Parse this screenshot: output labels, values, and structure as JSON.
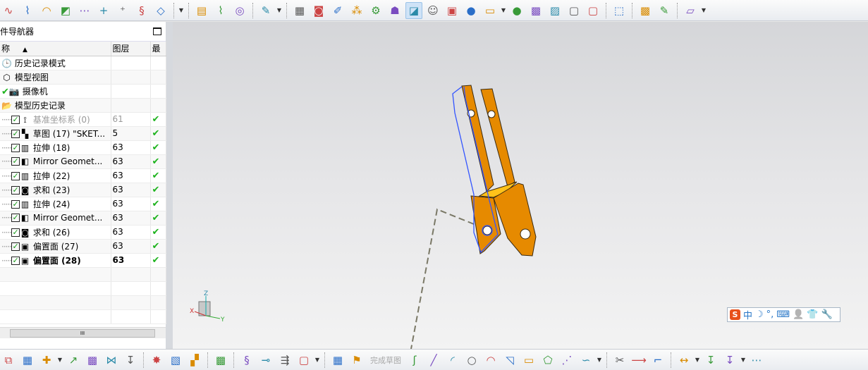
{
  "top_toolbar": {
    "icons": [
      "curve-icon",
      "spline-icon",
      "fillet-curve-icon",
      "surface-icon",
      "sketch-point-icon",
      "cross-icon",
      "points-icon",
      "helix-icon",
      "plane-icon",
      "sep",
      "dropdown",
      "sep",
      "cylinder-icon",
      "spring-icon",
      "coin-icon",
      "sep",
      "wrench-tool-icon",
      "dropdown",
      "sep",
      "clapper-icon",
      "camera-icon",
      "paint-icon",
      "molecule-icon",
      "gear-box-icon",
      "lamp-icon",
      "active:light-icon",
      "person-icon",
      "monitor-icon",
      "sphere-icon",
      "screen-icon",
      "dropdown",
      "grey-sphere-icon",
      "box-icon",
      "picture-icon",
      "wire-box-icon",
      "cube-outline-icon",
      "sep",
      "select-box-icon",
      "sep",
      "blue-box-icon",
      "edit-icon",
      "sep",
      "folder-view-icon",
      "dropdown"
    ]
  },
  "navigator": {
    "title": "件导航器",
    "columns": [
      "称",
      "图层",
      "最"
    ],
    "rows": [
      {
        "icon": "clock-icon",
        "glyph": "🕒",
        "label": "历史记录模式",
        "layer": "",
        "check": false,
        "indent": 0
      },
      {
        "icon": "model-view-icon",
        "glyph": "⬡",
        "label": "模型视图",
        "layer": "",
        "check": false,
        "indent": 0
      },
      {
        "icon": "camera-icon",
        "glyph": "📷",
        "label": "摄像机",
        "layer": "",
        "check": true,
        "indent": 0,
        "lead_check": true
      },
      {
        "icon": "folder-icon",
        "glyph": "📂",
        "label": "模型历史记录",
        "layer": "",
        "check": false,
        "indent": 0
      },
      {
        "icon": "datum-csys-icon",
        "glyph": "⟟",
        "label": "基准坐标系 (0)",
        "layer": "61",
        "check": true,
        "indent": 1,
        "grey": true
      },
      {
        "icon": "sketch-icon",
        "glyph": "▚",
        "label": "草图 (17) \"SKET...",
        "layer": "5",
        "check": true,
        "indent": 1
      },
      {
        "icon": "extrude-icon",
        "glyph": "▥",
        "label": "拉伸 (18)",
        "layer": "63",
        "check": true,
        "indent": 1
      },
      {
        "icon": "mirror-geometry-icon",
        "glyph": "◧",
        "label": "Mirror Geomet...",
        "layer": "63",
        "check": true,
        "indent": 1
      },
      {
        "icon": "extrude-icon",
        "glyph": "▥",
        "label": "拉伸 (22)",
        "layer": "63",
        "check": true,
        "indent": 1
      },
      {
        "icon": "unite-icon",
        "glyph": "◙",
        "label": "求和 (23)",
        "layer": "63",
        "check": true,
        "indent": 1
      },
      {
        "icon": "extrude-icon",
        "glyph": "▥",
        "label": "拉伸 (24)",
        "layer": "63",
        "check": true,
        "indent": 1
      },
      {
        "icon": "mirror-geometry-icon",
        "glyph": "◧",
        "label": "Mirror Geomet...",
        "layer": "63",
        "check": true,
        "indent": 1
      },
      {
        "icon": "unite-icon",
        "glyph": "◙",
        "label": "求和 (26)",
        "layer": "63",
        "check": true,
        "indent": 1
      },
      {
        "icon": "offset-face-icon",
        "glyph": "▣",
        "label": "偏置面 (27)",
        "layer": "63",
        "check": true,
        "indent": 1
      },
      {
        "icon": "offset-face-icon",
        "glyph": "▣",
        "label": "偏置面 (28)",
        "layer": "63",
        "check": true,
        "indent": 1,
        "bold": true
      }
    ],
    "empty_rows": 4,
    "scroll_grip": "III"
  },
  "viewport": {
    "axis_labels": {
      "x": "X",
      "y": "Y",
      "z": "Z"
    },
    "part_color": "#e68a00"
  },
  "ime_bar": {
    "logo": "S",
    "mode": "中",
    "items": [
      "moon-icon",
      "punctuation-icon",
      "keyboard-icon",
      "user-icon",
      "skin-icon",
      "settings-wrench-icon"
    ],
    "moon": "☽",
    "punct": "°,",
    "kbd": "⌨",
    "user": "👤",
    "shirt": "👕",
    "wrench": "🔧"
  },
  "bottom_toolbar": {
    "finish_sketch": "完成草图",
    "icons": [
      "assembly-icon",
      "grid-icon",
      "add-component-icon",
      "dropdown",
      "move-component-icon",
      "box-yellow-icon",
      "mirror-assembly-icon",
      "constraint-icon",
      "sep",
      "explode-icon",
      "blocks-icon",
      "arrange-icon",
      "sep",
      "box-icon",
      "sep",
      "chain-icon",
      "pipe-icon",
      "route-icon",
      "cube-icon",
      "dropdown",
      "sep",
      "sketch-grid-icon",
      "finish-flag-icon",
      "TEXT",
      "profile-icon",
      "line-icon",
      "arc-icon",
      "circle-icon",
      "fillet-icon",
      "chamfer-icon",
      "rectangle-icon",
      "polygon-icon",
      "point-icon",
      "studio-spline-icon",
      "dropdown",
      "sep",
      "trim-icon",
      "extend-icon",
      "corner-icon",
      "sep",
      "dimension-icon",
      "dropdown",
      "constraint-vertical-icon",
      "constraint-angle-icon",
      "dropdown",
      "sketch-more-icon"
    ]
  }
}
